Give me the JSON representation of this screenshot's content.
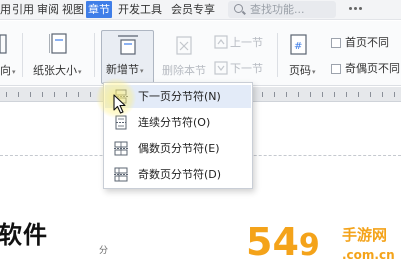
{
  "menubar": {
    "items": [
      "用",
      "引用",
      "审阅",
      "视图",
      "章节",
      "开发工具",
      "会员专享"
    ],
    "active": "章节",
    "search_placeholder": "查找功能..."
  },
  "ribbon": {
    "direction_label": "向",
    "paper_size_label": "纸张大小",
    "new_section_label": "新增节",
    "delete_section_label": "删除本节",
    "prev_section_label": "上一节",
    "next_section_label": "下一节",
    "page_number_label": "页码",
    "first_page_diff_label": "首页不同",
    "odd_even_diff_label": "奇偶页不同"
  },
  "dropdown": {
    "items": [
      {
        "label": "下一页分节符(N)",
        "icon": "next-page-break-icon"
      },
      {
        "label": "连续分节符(O)",
        "icon": "continuous-break-icon"
      },
      {
        "label": "偶数页分节符(E)",
        "icon": "even-page-break-icon"
      },
      {
        "label": "奇数页分节符(D)",
        "icon": "odd-page-break-icon"
      }
    ],
    "hovered_index": 0
  },
  "document": {
    "heading": "软件",
    "fragment": "分"
  },
  "watermark": {
    "main": "54",
    "mid": "9",
    "side_text": "手游网",
    "url_text": ".com.cn"
  },
  "colors": {
    "accent": "#3f7ee8",
    "watermark": "#f4a31a"
  }
}
